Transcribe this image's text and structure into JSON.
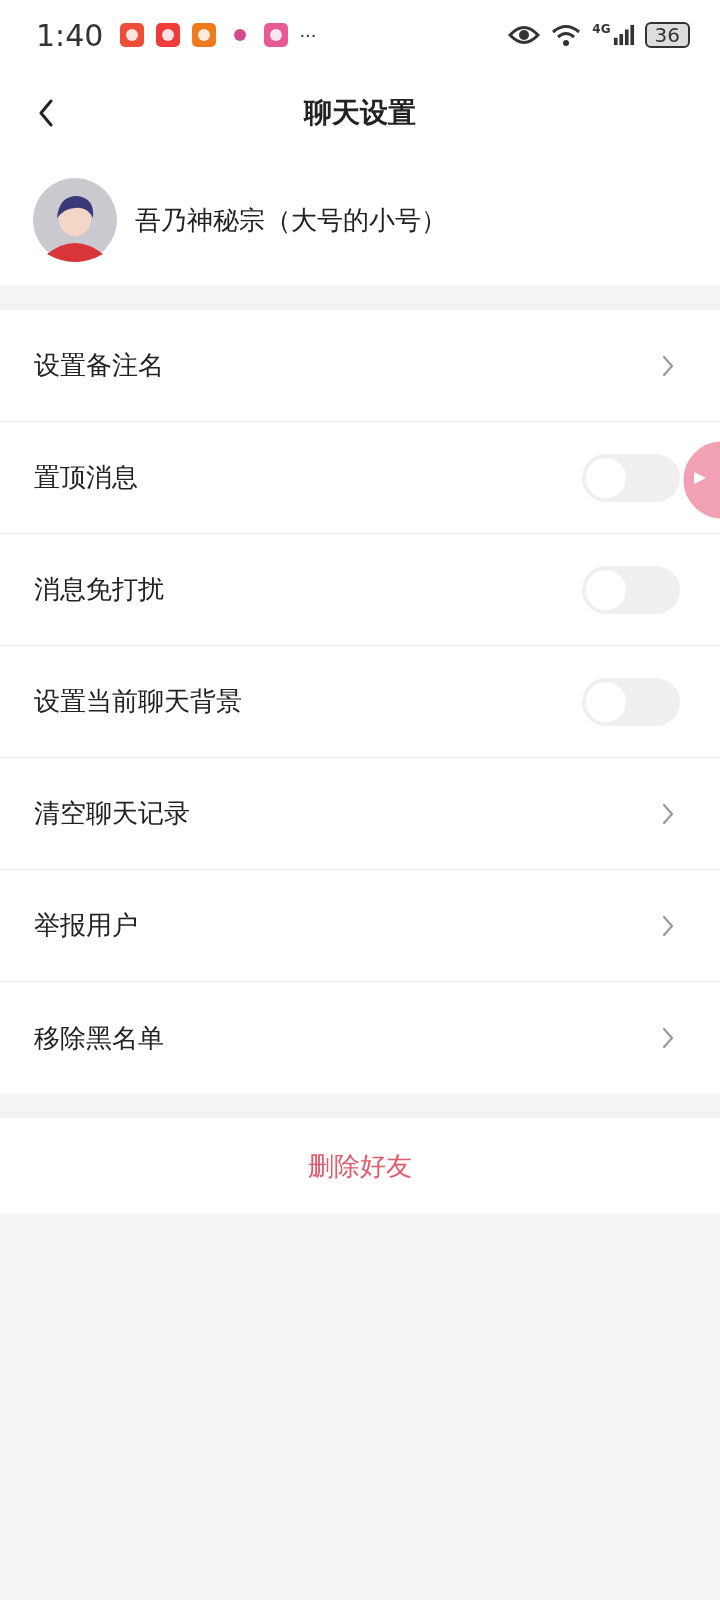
{
  "status_bar": {
    "time": "1:40",
    "more": "···",
    "battery": "36",
    "network": "4G"
  },
  "header": {
    "title": "聊天设置"
  },
  "profile": {
    "name": "吾乃神秘宗（大号的小号）"
  },
  "settings": [
    {
      "kind": "link",
      "label": "设置备注名"
    },
    {
      "kind": "toggle",
      "label": "置顶消息",
      "on": false
    },
    {
      "kind": "toggle",
      "label": "消息免打扰",
      "on": false
    },
    {
      "kind": "toggle",
      "label": "设置当前聊天背景",
      "on": false
    },
    {
      "kind": "link",
      "label": "清空聊天记录"
    },
    {
      "kind": "link",
      "label": "举报用户"
    },
    {
      "kind": "link",
      "label": "移除黑名单"
    }
  ],
  "delete_button": "删除好友"
}
